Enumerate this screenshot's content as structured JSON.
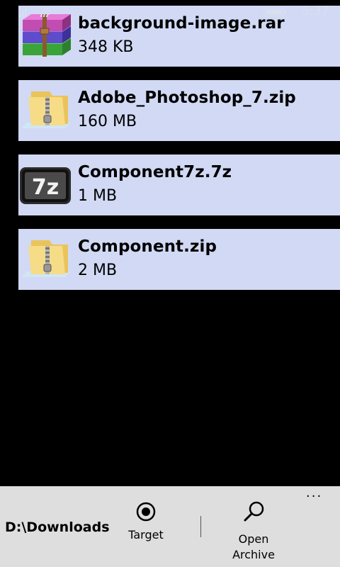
{
  "status_bar": {
    "time": "5:37"
  },
  "files": [
    {
      "name": "background-image.rar",
      "size": "348 KB",
      "icon": "winrar-archive-icon"
    },
    {
      "name": "Adobe_Photoshop_7.zip",
      "size": "160 MB",
      "icon": "zip-folder-icon"
    },
    {
      "name": "Component7z.7z",
      "size": "1 MB",
      "icon": "7z-archive-icon"
    },
    {
      "name": "Component.zip",
      "size": "2 MB",
      "icon": "zip-folder-icon"
    }
  ],
  "app_bar": {
    "path": "D:\\Downloads",
    "target_label": "Target",
    "open_archive_label": "Open Archive",
    "more_glyph": "..."
  },
  "colors": {
    "item_background": "#d1d9f4",
    "app_bar_background": "#dedede",
    "page_background": "#000000"
  }
}
